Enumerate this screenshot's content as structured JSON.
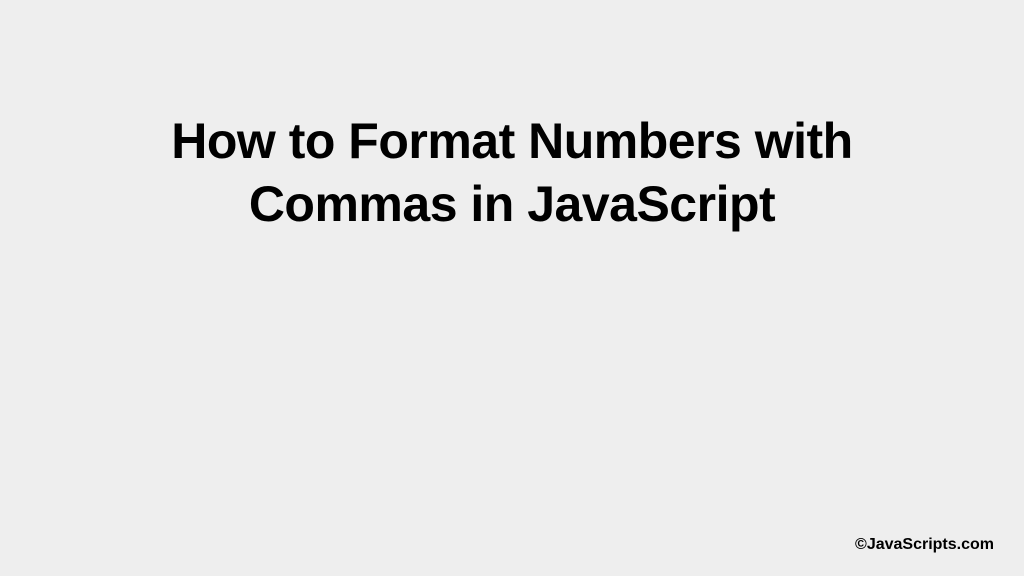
{
  "title": "How to Format Numbers with Commas in JavaScript",
  "attribution": "©JavaScripts.com"
}
